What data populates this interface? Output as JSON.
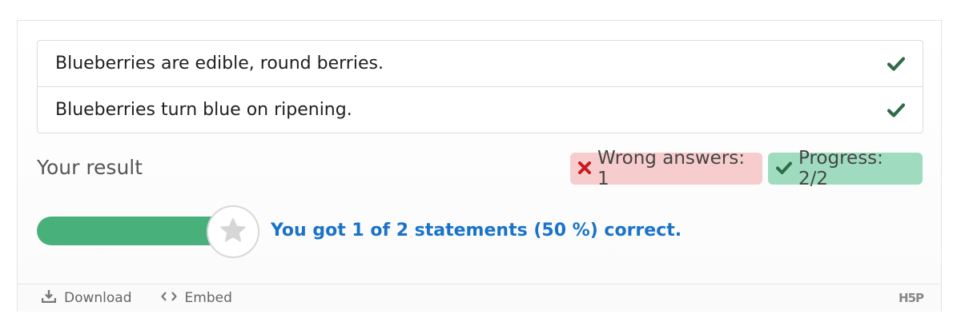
{
  "statements": [
    {
      "text": "Blueberries are edible, round berries.",
      "status": "correct",
      "icon": "check-icon"
    },
    {
      "text": "Blueberries turn blue on ripening.",
      "status": "correct",
      "icon": "check-icon"
    }
  ],
  "result": {
    "title": "Your result",
    "wrong_label": "Wrong answers: 1",
    "progress_label": "Progress: 2/2",
    "score_text": "You got 1 of 2 statements (50 %) correct.",
    "score_fraction": 0.5
  },
  "footer": {
    "download_label": "Download",
    "embed_label": "Embed",
    "logo_text": "H5P"
  },
  "colors": {
    "check": "#2e6b46",
    "wrong_bg": "#f6cccc",
    "wrong_icon": "#c9191e",
    "progress_bg": "#9fdcbf",
    "bar": "#48b07a",
    "score_text": "#1a73c8"
  }
}
